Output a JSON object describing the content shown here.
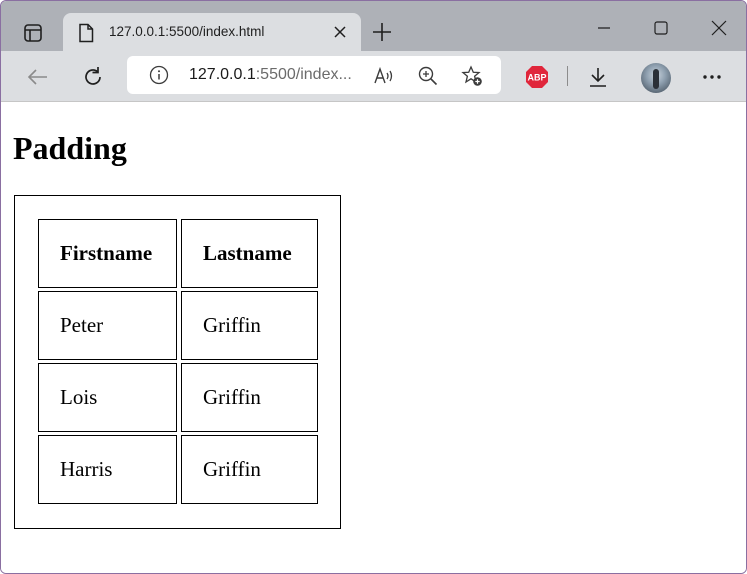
{
  "browser": {
    "tab": {
      "title": "127.0.0.1:5500/index.html"
    },
    "url": {
      "host": "127.0.0.1",
      "rest": ":5500/index..."
    },
    "icons": {
      "tab_actions": "tab-actions-icon",
      "favicon": "page-icon",
      "tab_close": "close-icon",
      "new_tab": "plus-icon",
      "minimize": "minimize-icon",
      "maximize": "maximize-icon",
      "close_window": "close-icon",
      "back": "back-arrow-icon",
      "refresh": "refresh-icon",
      "site_info": "info-icon",
      "read_aloud": "read-aloud-icon",
      "zoom": "zoom-in-icon",
      "favorites": "add-favorite-icon",
      "adblock": "adblock-icon",
      "downloads": "download-icon",
      "profile": "avatar",
      "more": "more-icon"
    },
    "adblock_label": "ABP"
  },
  "page": {
    "heading": "Padding",
    "table": {
      "headers": [
        "Firstname",
        "Lastname"
      ],
      "rows": [
        [
          "Peter",
          "Griffin"
        ],
        [
          "Lois",
          "Griffin"
        ],
        [
          "Harris",
          "Griffin"
        ]
      ]
    }
  },
  "colors": {
    "tabstrip": "#aeb1b7",
    "toolbar": "#dcdee1",
    "adblock": "#e0263b"
  }
}
